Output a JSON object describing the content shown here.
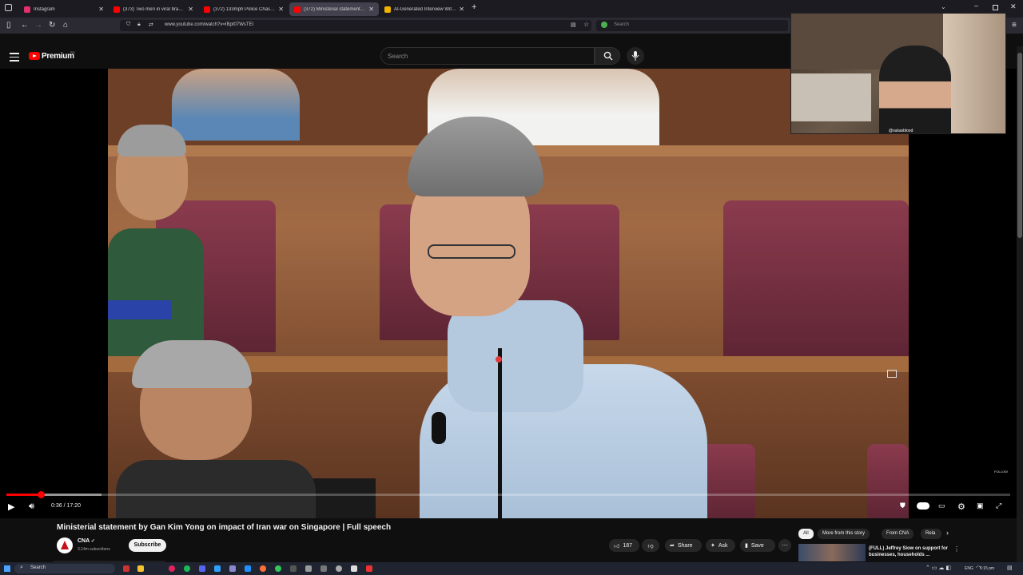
{
  "browser": {
    "tabs": [
      {
        "label": "Instagram",
        "color": "#e1306c",
        "active": false
      },
      {
        "label": "(373) Two men in viral brawl at",
        "color": "#ff0000",
        "active": false
      },
      {
        "label": "(372) 133mph Police Chase End",
        "color": "#ff0000",
        "active": false
      },
      {
        "label": "(372) Ministerial statement by G",
        "color": "#ff0000",
        "active": true
      },
      {
        "label": "AI-Generated Interview With C",
        "color": "#f0b400",
        "active": false
      }
    ],
    "new_tab_icon": "plus-icon",
    "url": "www.youtube.com/watch?v=IBpt07WsTEI",
    "search_placeholder": "Search"
  },
  "youtube": {
    "brand": "Premium",
    "country_code": "SG",
    "search_placeholder": "Search",
    "brand_color": "#ff0000"
  },
  "webcam": {
    "handle": "@sukasblood"
  },
  "player": {
    "time": "0:36 / 17:20",
    "progress_fraction": 0.0346,
    "buffer_fraction": 0.095,
    "follow_label": "FOLLOW"
  },
  "video": {
    "title": "Ministerial statement by Gan Kim Yong on impact of Iran war on Singapore | Full speech",
    "channel": "CNA",
    "verified_icon": "verified-icon",
    "subscribers": "3.14m subscribers",
    "subscribe_label": "Subscribe",
    "likes": "187",
    "share_label": "Share",
    "ask_label": "Ask",
    "save_label": "Save"
  },
  "chips": [
    "All",
    "More from this story",
    "From CNA",
    "Rela"
  ],
  "recommendation": {
    "title": "(FULL) Jeffrey Siow on support for businesses, households ..."
  },
  "taskbar": {
    "search_label": "Search",
    "lang": "ENG",
    "clock": "6:15 pm"
  }
}
